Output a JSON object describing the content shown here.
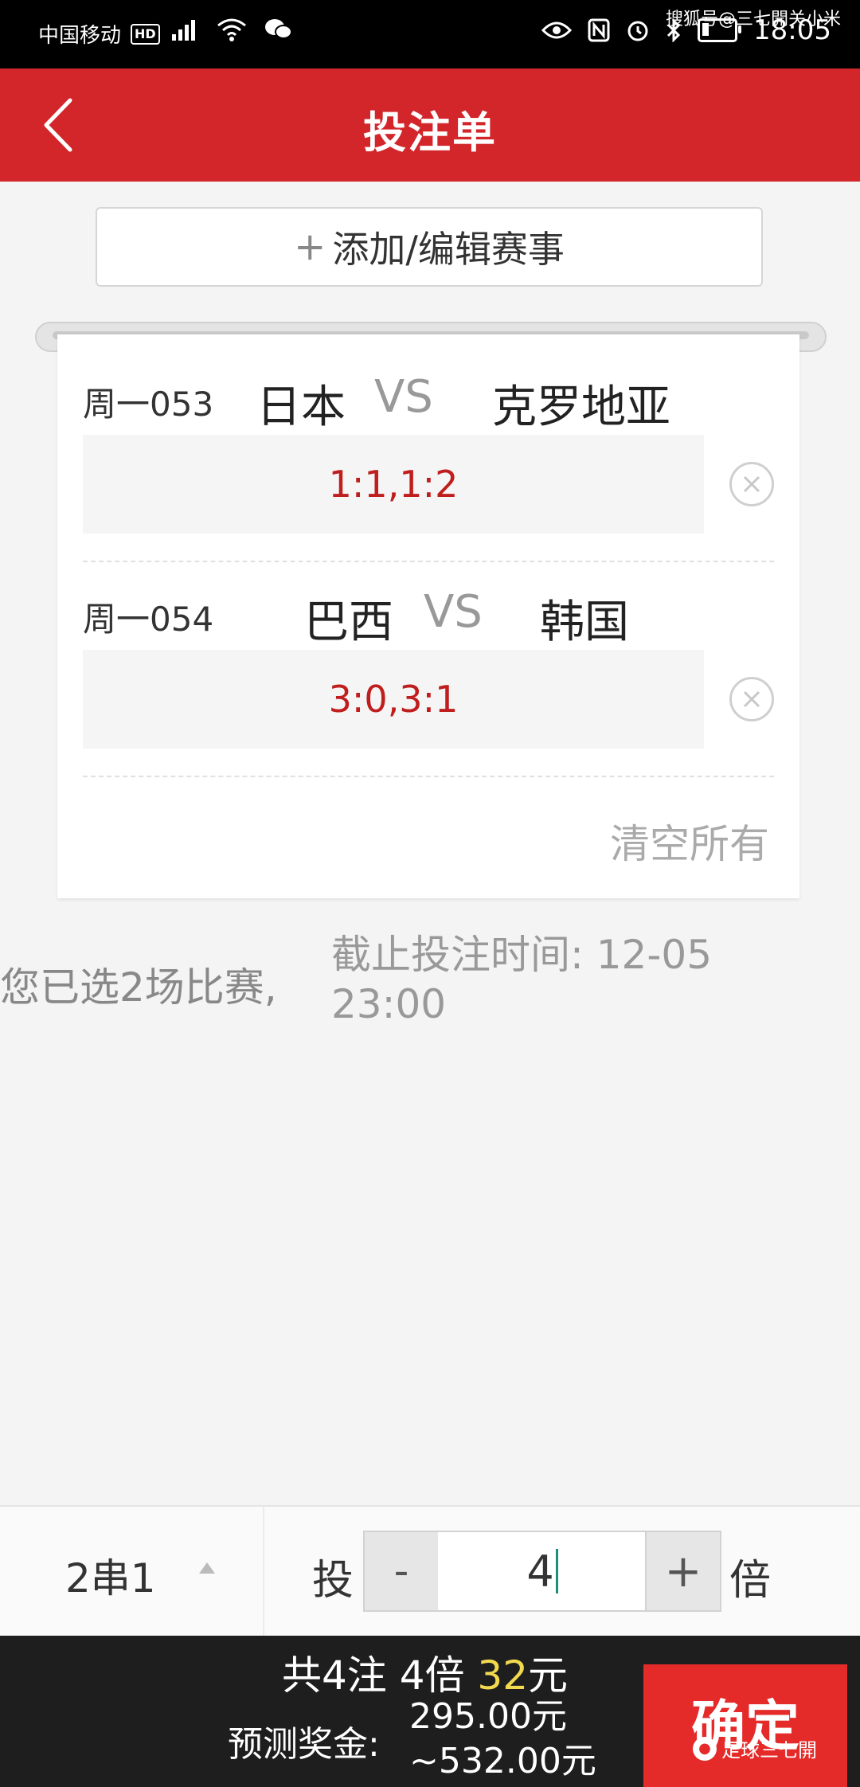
{
  "status_bar": {
    "carrier": "中国移动",
    "hd": "HD",
    "time": "18:05",
    "watermark": "搜狐号@三七開关小米"
  },
  "header": {
    "title": "投注单"
  },
  "add_button": {
    "plus": "+",
    "label": "添加/编辑赛事"
  },
  "matches": [
    {
      "code": "周一053",
      "home": "日本",
      "vs": "VS",
      "away": "克罗地亚",
      "picks": "1:1,1:2"
    },
    {
      "code": "周一054",
      "home": "巴西",
      "vs": "VS",
      "away": "韩国",
      "picks": "3:0,3:1"
    }
  ],
  "clear_all": "清空所有",
  "info": {
    "selected": "您已选2场比赛,",
    "deadline_line1": "截止投注时间: 12-05",
    "deadline_line2": "23:00"
  },
  "controls": {
    "combo": "2串1",
    "tou": "投",
    "minus": "-",
    "multiple": "4",
    "plus": "+",
    "bei": "倍"
  },
  "footer": {
    "summary_prefix": "共4注 4倍 ",
    "summary_amount": "32",
    "summary_unit": "元",
    "prize_label": "预测奖金:",
    "prize_min": "295.00元",
    "prize_max": "~532.00元",
    "confirm": "确定",
    "watermark": "足球三七開"
  },
  "colors": {
    "brand_red": "#d3262b",
    "pick_red": "#c01d1d",
    "highlight_yellow": "#f2d94e"
  }
}
